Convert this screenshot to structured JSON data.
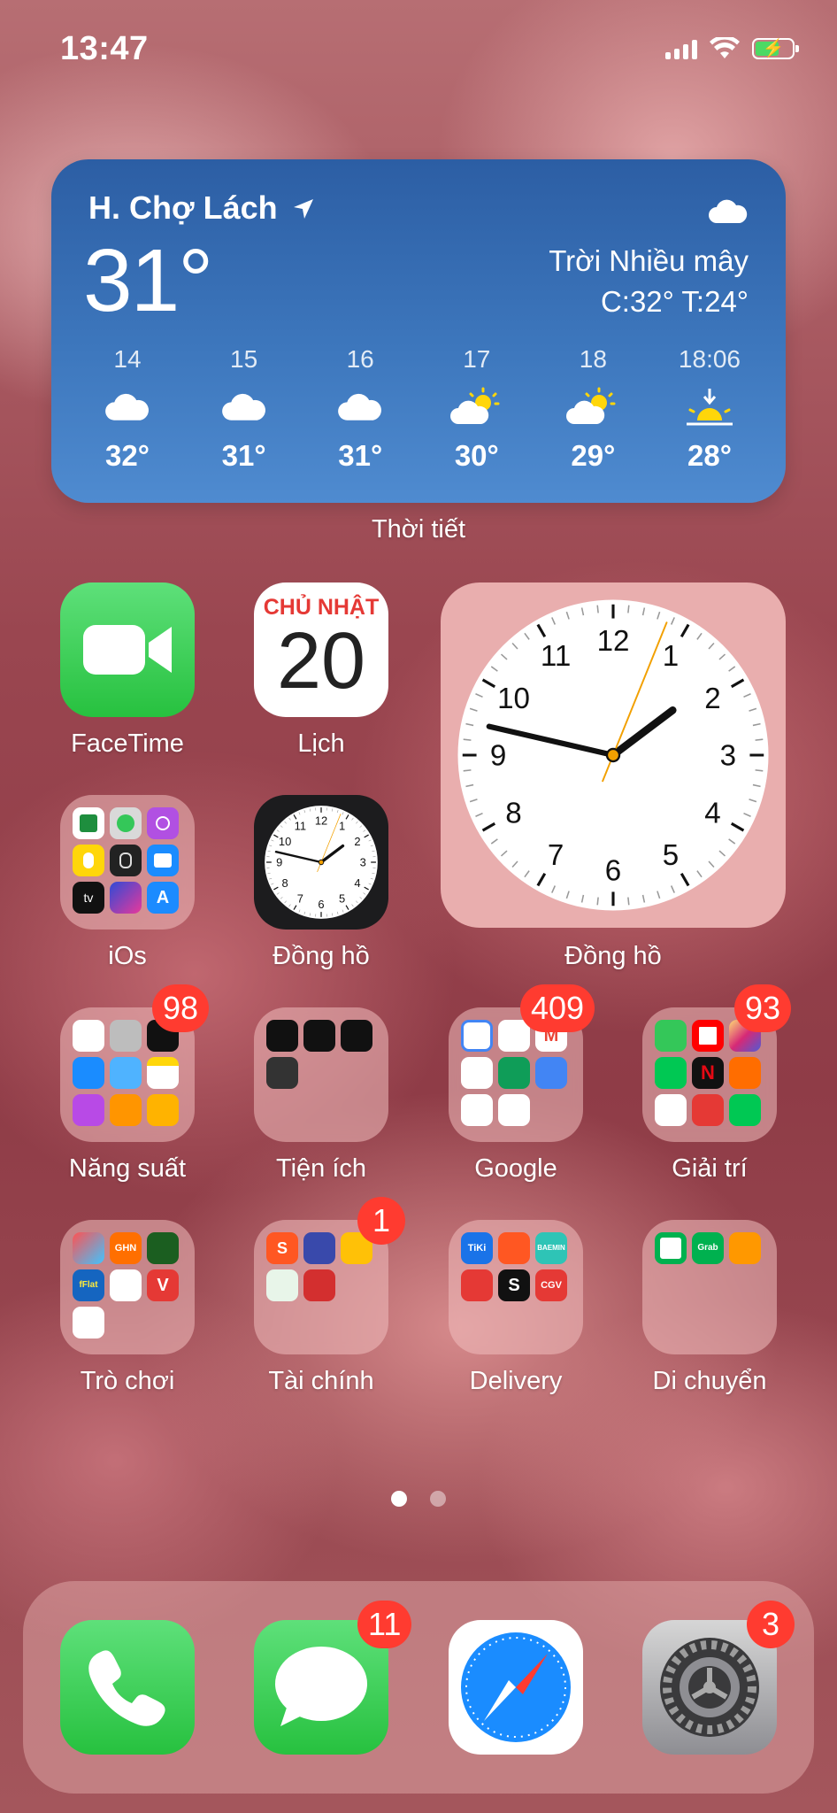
{
  "status": {
    "time": "13:47"
  },
  "weather": {
    "location": "H. Chợ Lách",
    "temperature": "31°",
    "condition": "Trời Nhiều mây",
    "high_low": "C:32° T:24°",
    "hours": [
      {
        "time": "14",
        "temp": "32°",
        "icon": "cloud-icon"
      },
      {
        "time": "15",
        "temp": "31°",
        "icon": "cloud-icon"
      },
      {
        "time": "16",
        "temp": "31°",
        "icon": "cloud-icon"
      },
      {
        "time": "17",
        "temp": "30°",
        "icon": "partly-sunny-icon"
      },
      {
        "time": "18",
        "temp": "29°",
        "icon": "partly-sunny-icon"
      },
      {
        "time": "18:06",
        "temp": "28°",
        "icon": "sunset-icon"
      }
    ],
    "widget_label": "Thời tiết"
  },
  "apps": {
    "facetime": "FaceTime",
    "calendar": {
      "label": "Lịch",
      "weekday": "CHỦ NHẬT",
      "day": "20"
    },
    "clock_widget_label": "Đồng hồ",
    "ios_folder": "iOs",
    "clock": "Đồng hồ",
    "nang_suat": {
      "label": "Năng suất",
      "badge": "98"
    },
    "tien_ich": "Tiện ích",
    "google": {
      "label": "Google",
      "badge": "409"
    },
    "giai_tri": {
      "label": "Giải trí",
      "badge": "93"
    },
    "tro_choi": "Trò chơi",
    "tai_chinh": {
      "label": "Tài chính",
      "badge": "1"
    },
    "delivery": "Delivery",
    "di_chuyen": "Di chuyển"
  },
  "folder_icons": {
    "tro_choi": [
      "GHN",
      "fFlat"
    ],
    "delivery": [
      "TiKi",
      "BAEMIN",
      "S",
      "CGV"
    ],
    "di_chuyen": [
      "Grab"
    ]
  },
  "clock_faces": {
    "numbers": [
      "12",
      "1",
      "2",
      "3",
      "4",
      "5",
      "6",
      "7",
      "8",
      "9",
      "10",
      "11"
    ]
  },
  "dock": {
    "messages_badge": "11",
    "settings_badge": "3"
  },
  "colors": {
    "badge": "#ff3b30",
    "weather_top": "#2c5ea4",
    "green": "#34c759"
  }
}
